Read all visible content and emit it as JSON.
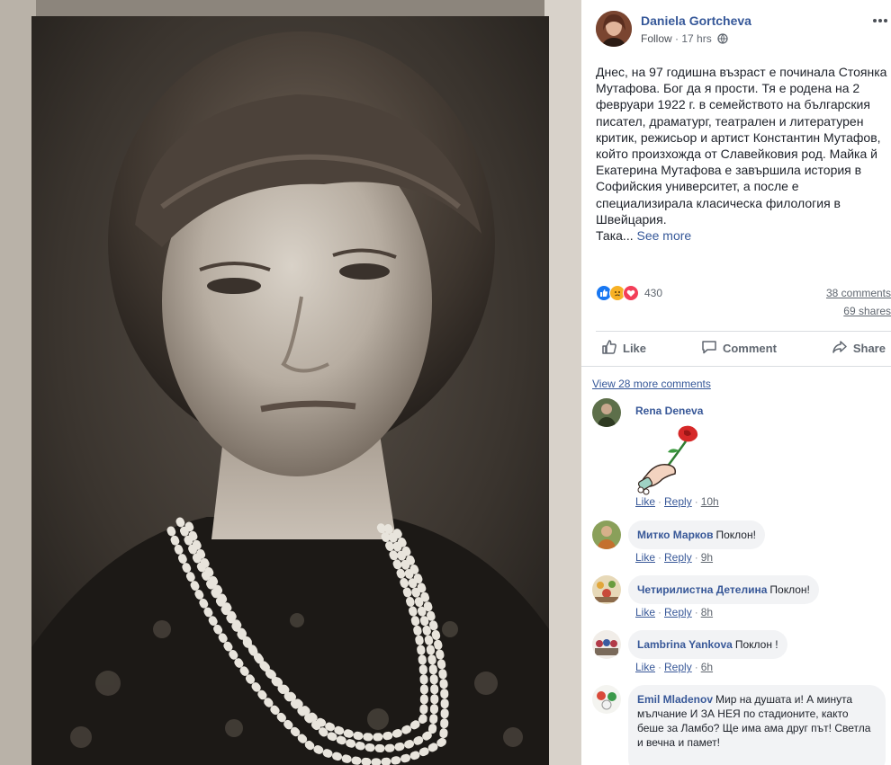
{
  "post": {
    "author": "Daniela Gortcheva",
    "follow_label": "Follow",
    "time_separator": "·",
    "time": "17 hrs",
    "text": "Днес, на 97 годишна възраст е починала Стоянка Мутафова. Бог да я прости. Тя е родена на 2 февруари 1922 г. в семейството на българския писател, драматург, театрален и литературен критик, режисьор и артист Константин Мутафов, който произхожда от Славейковия род. Майка й Екатерина Мутафова е завършила история в Софийския университет, а после е специализирала класическа филология в Швейцария.",
    "text_tail": "Така...",
    "see_more": "See more",
    "more_options": "•••"
  },
  "stats": {
    "reaction_count": "430",
    "reactions": [
      "like",
      "sad",
      "love"
    ],
    "comments": "38 comments",
    "shares": "69 shares"
  },
  "actions": {
    "like": "Like",
    "comment": "Comment",
    "share": "Share"
  },
  "comments_section": {
    "view_more": "View 28 more comments",
    "like_label": "Like",
    "reply_label": "Reply",
    "separator": "·",
    "items": [
      {
        "name": "Rena Deneva",
        "text": "",
        "time": "10h",
        "sticker": "hand-with-rose"
      },
      {
        "name": "Митко Марков",
        "text": "Поклон!",
        "time": "9h"
      },
      {
        "name": "Четирилистна Детелина",
        "text": "Поклон!",
        "time": "8h"
      },
      {
        "name": "Lambrina Yankova",
        "text": "Поклон !",
        "time": "6h"
      },
      {
        "name": "Emil Mladenov",
        "text": "Мир на душата и! А минута мълчание И ЗА НЕЯ по стадионите, както беше за Ламбо? Ще има ама друг път! Светла и вечна и памет!",
        "time": ""
      }
    ]
  },
  "colors": {
    "link": "#365899",
    "secondary_text": "#606770",
    "bubble_bg": "#f2f3f5",
    "divider": "#dadde1",
    "like_blue": "#1877f2",
    "love_red": "#f33e58",
    "sad_yellow": "#f7b125"
  },
  "icons": [
    "globe-icon",
    "like-thumb-icon",
    "comment-bubble-icon",
    "share-arrow-icon",
    "more-dots-icon"
  ]
}
